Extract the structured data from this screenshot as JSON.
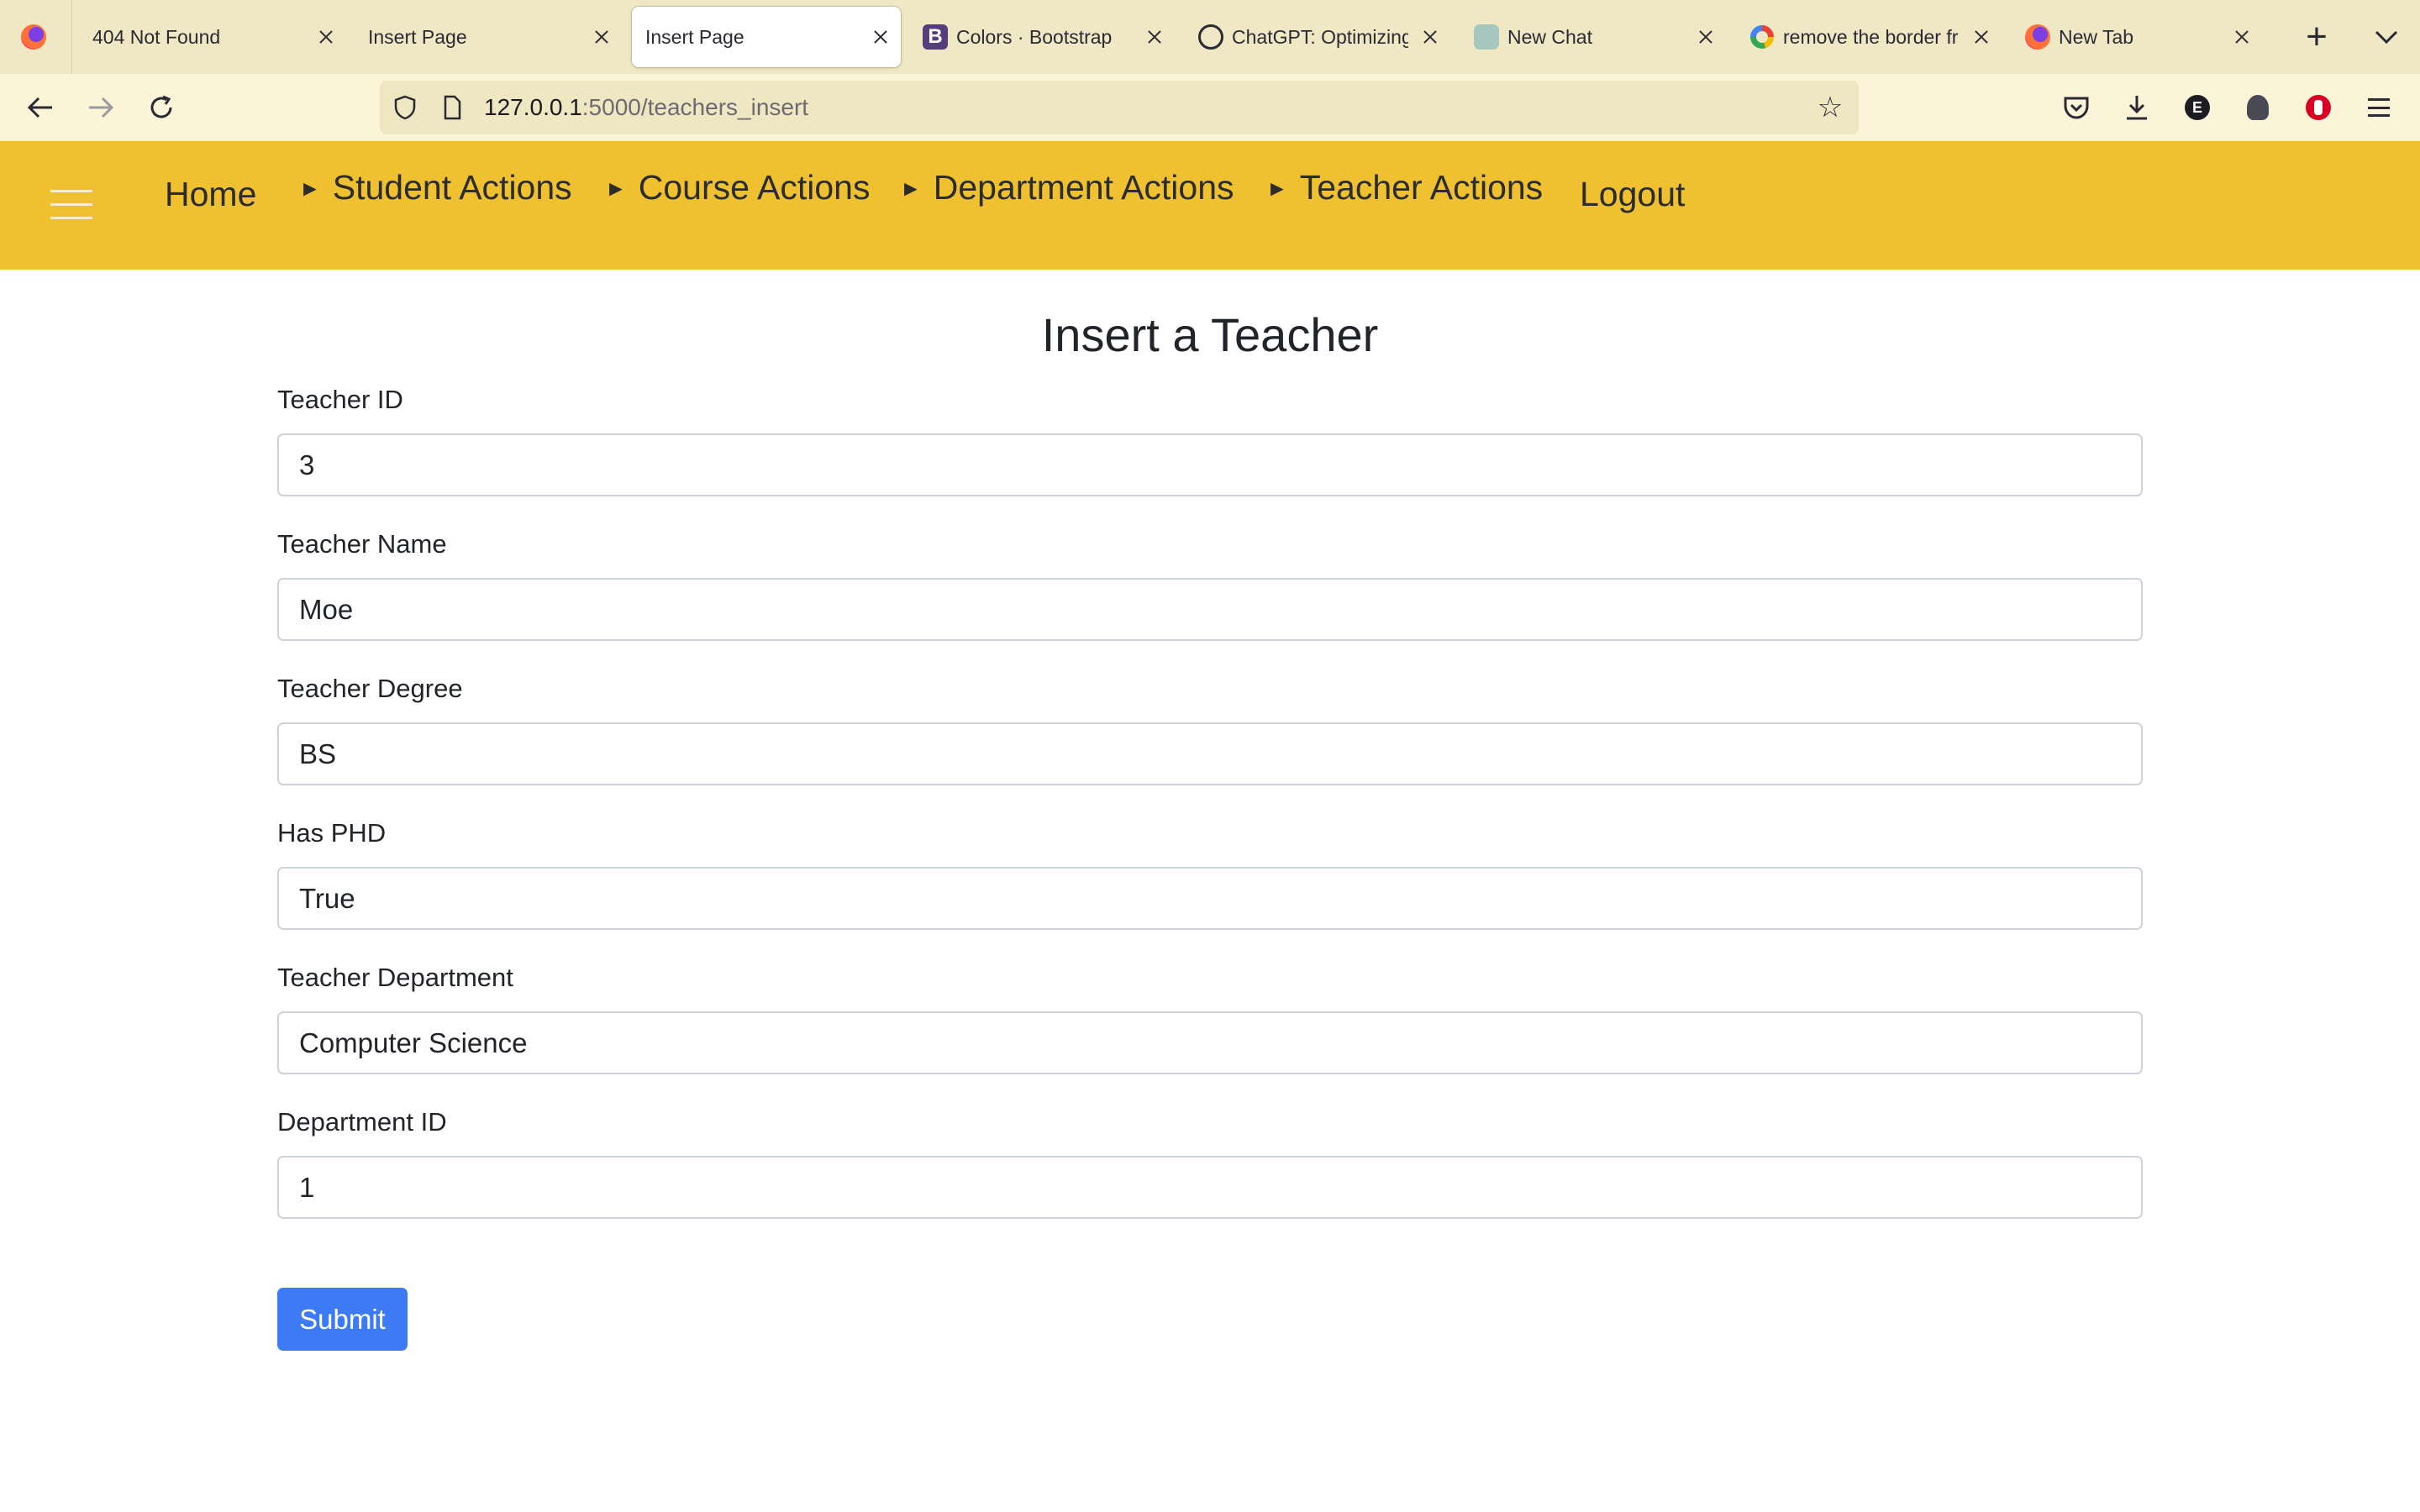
{
  "browser": {
    "tabs": [
      {
        "title": "404 Not Found",
        "icon": "page-icon"
      },
      {
        "title": "Insert Page",
        "icon": "page-icon"
      },
      {
        "title": "Insert Page",
        "icon": "page-icon",
        "active": true
      },
      {
        "title": "Colors · Bootstrap",
        "icon": "bootstrap-icon"
      },
      {
        "title": "ChatGPT: Optimizing",
        "icon": "chatgpt-icon"
      },
      {
        "title": "New Chat",
        "icon": "chat-icon"
      },
      {
        "title": "remove the border fr",
        "icon": "google-icon"
      },
      {
        "title": "New Tab",
        "icon": "firefox-icon"
      }
    ],
    "url_host": "127.0.0.1",
    "url_path": ":5000/teachers_insert",
    "extension_letter": "E"
  },
  "site_nav": {
    "home": "Home",
    "student_actions": "Student Actions",
    "course_actions": "Course Actions",
    "department_actions": "Department Actions",
    "teacher_actions": "Teacher Actions",
    "logout": "Logout",
    "arrow": "►"
  },
  "form": {
    "title": "Insert a Teacher",
    "fields": [
      {
        "label": "Teacher ID",
        "value": "3"
      },
      {
        "label": "Teacher Name",
        "value": "Moe"
      },
      {
        "label": "Teacher Degree",
        "value": "BS"
      },
      {
        "label": "Has PHD",
        "value": "True"
      },
      {
        "label": "Teacher Department",
        "value": "Computer Science"
      },
      {
        "label": "Department ID",
        "value": "1"
      }
    ],
    "submit_label": "Submit"
  },
  "colors": {
    "nav_background": "#efc02f",
    "submit_button": "#3d7bf6",
    "browser_chrome": "#f0e7c4"
  }
}
